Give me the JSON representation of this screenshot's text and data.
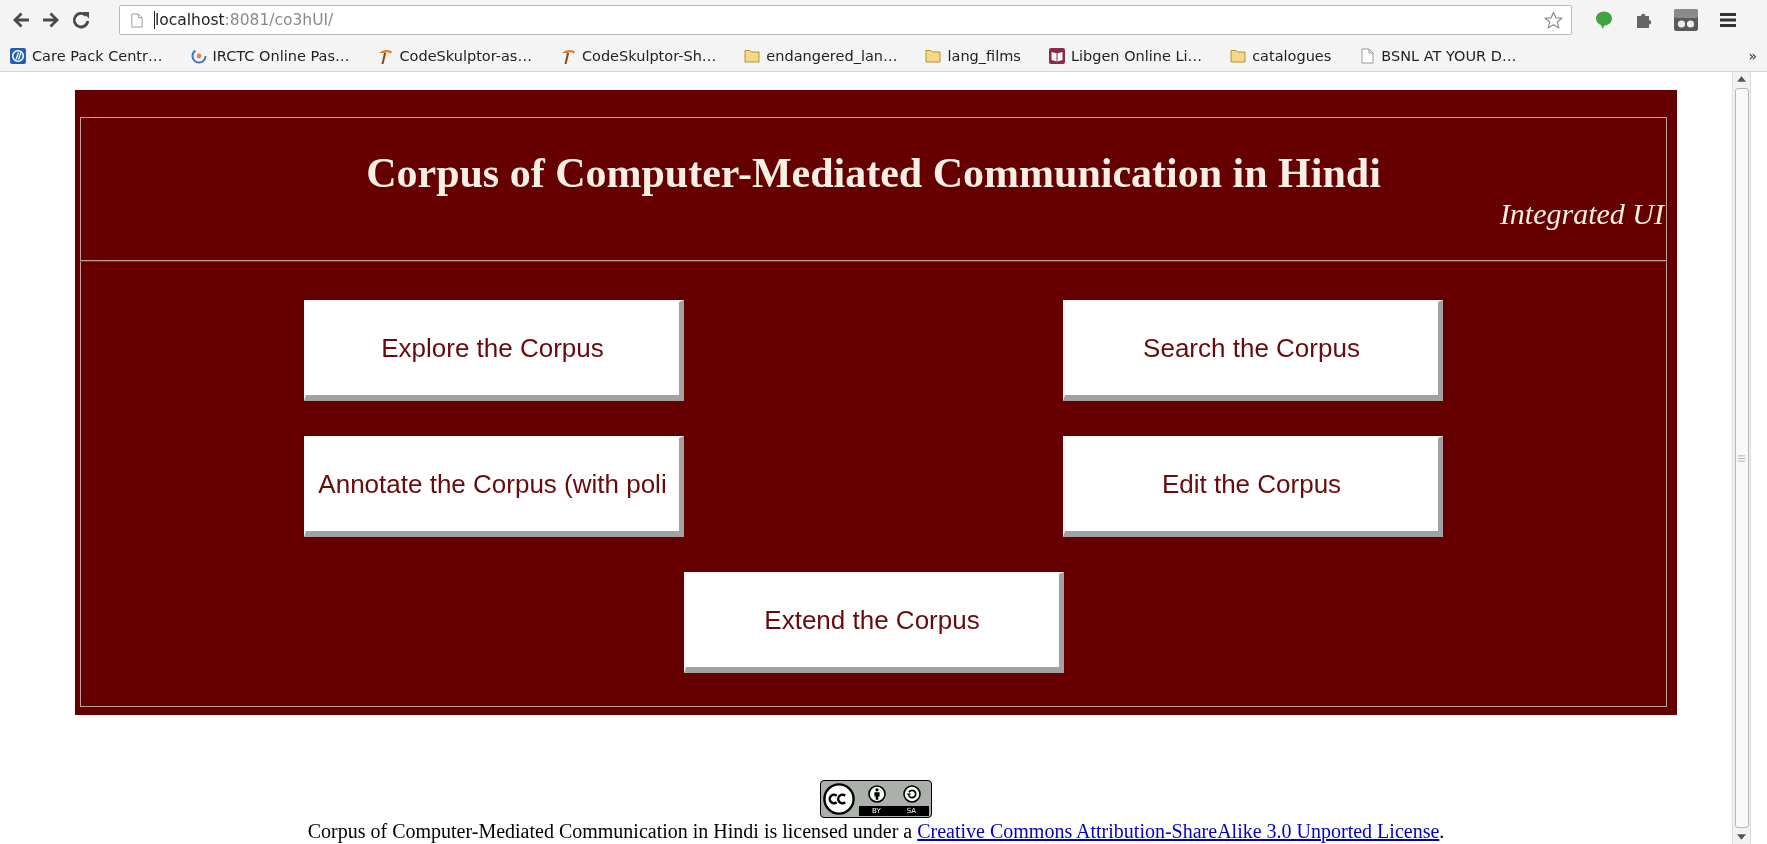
{
  "browser": {
    "address": {
      "host": "localhost",
      "path": ":8081/co3hUI/"
    },
    "bookmarks": [
      {
        "label": "Care Pack Centr…",
        "kind": "logo"
      },
      {
        "label": "IRCTC Online Pas…",
        "kind": "swirl"
      },
      {
        "label": "CodeSkulptor-as…",
        "kind": "hammer"
      },
      {
        "label": "CodeSkulptor-Sh…",
        "kind": "hammer"
      },
      {
        "label": "endangered_lan…",
        "kind": "folder"
      },
      {
        "label": "lang_films",
        "kind": "folder"
      },
      {
        "label": "Libgen Online Li…",
        "kind": "book"
      },
      {
        "label": "catalogues",
        "kind": "folder"
      },
      {
        "label": "BSNL AT YOUR D…",
        "kind": "page"
      }
    ],
    "more_bookmarks": "»"
  },
  "header": {
    "title": "Corpus of Computer-Mediated Communication in Hindi",
    "subtitle": "Integrated UI"
  },
  "menu": {
    "rows": [
      [
        "Explore the Corpus",
        "Search the Corpus"
      ],
      [
        "Annotate the Corpus (with poli",
        "Edit the Corpus"
      ],
      [
        "Extend the Corpus"
      ]
    ]
  },
  "footer": {
    "badge_labels": [
      "BY",
      "SA"
    ],
    "text": "Corpus of Computer-Mediated Communication in Hindi is licensed under a",
    "link": "Creative Commons Attribution-ShareAlike 3.0 Unported License",
    "end": "."
  }
}
